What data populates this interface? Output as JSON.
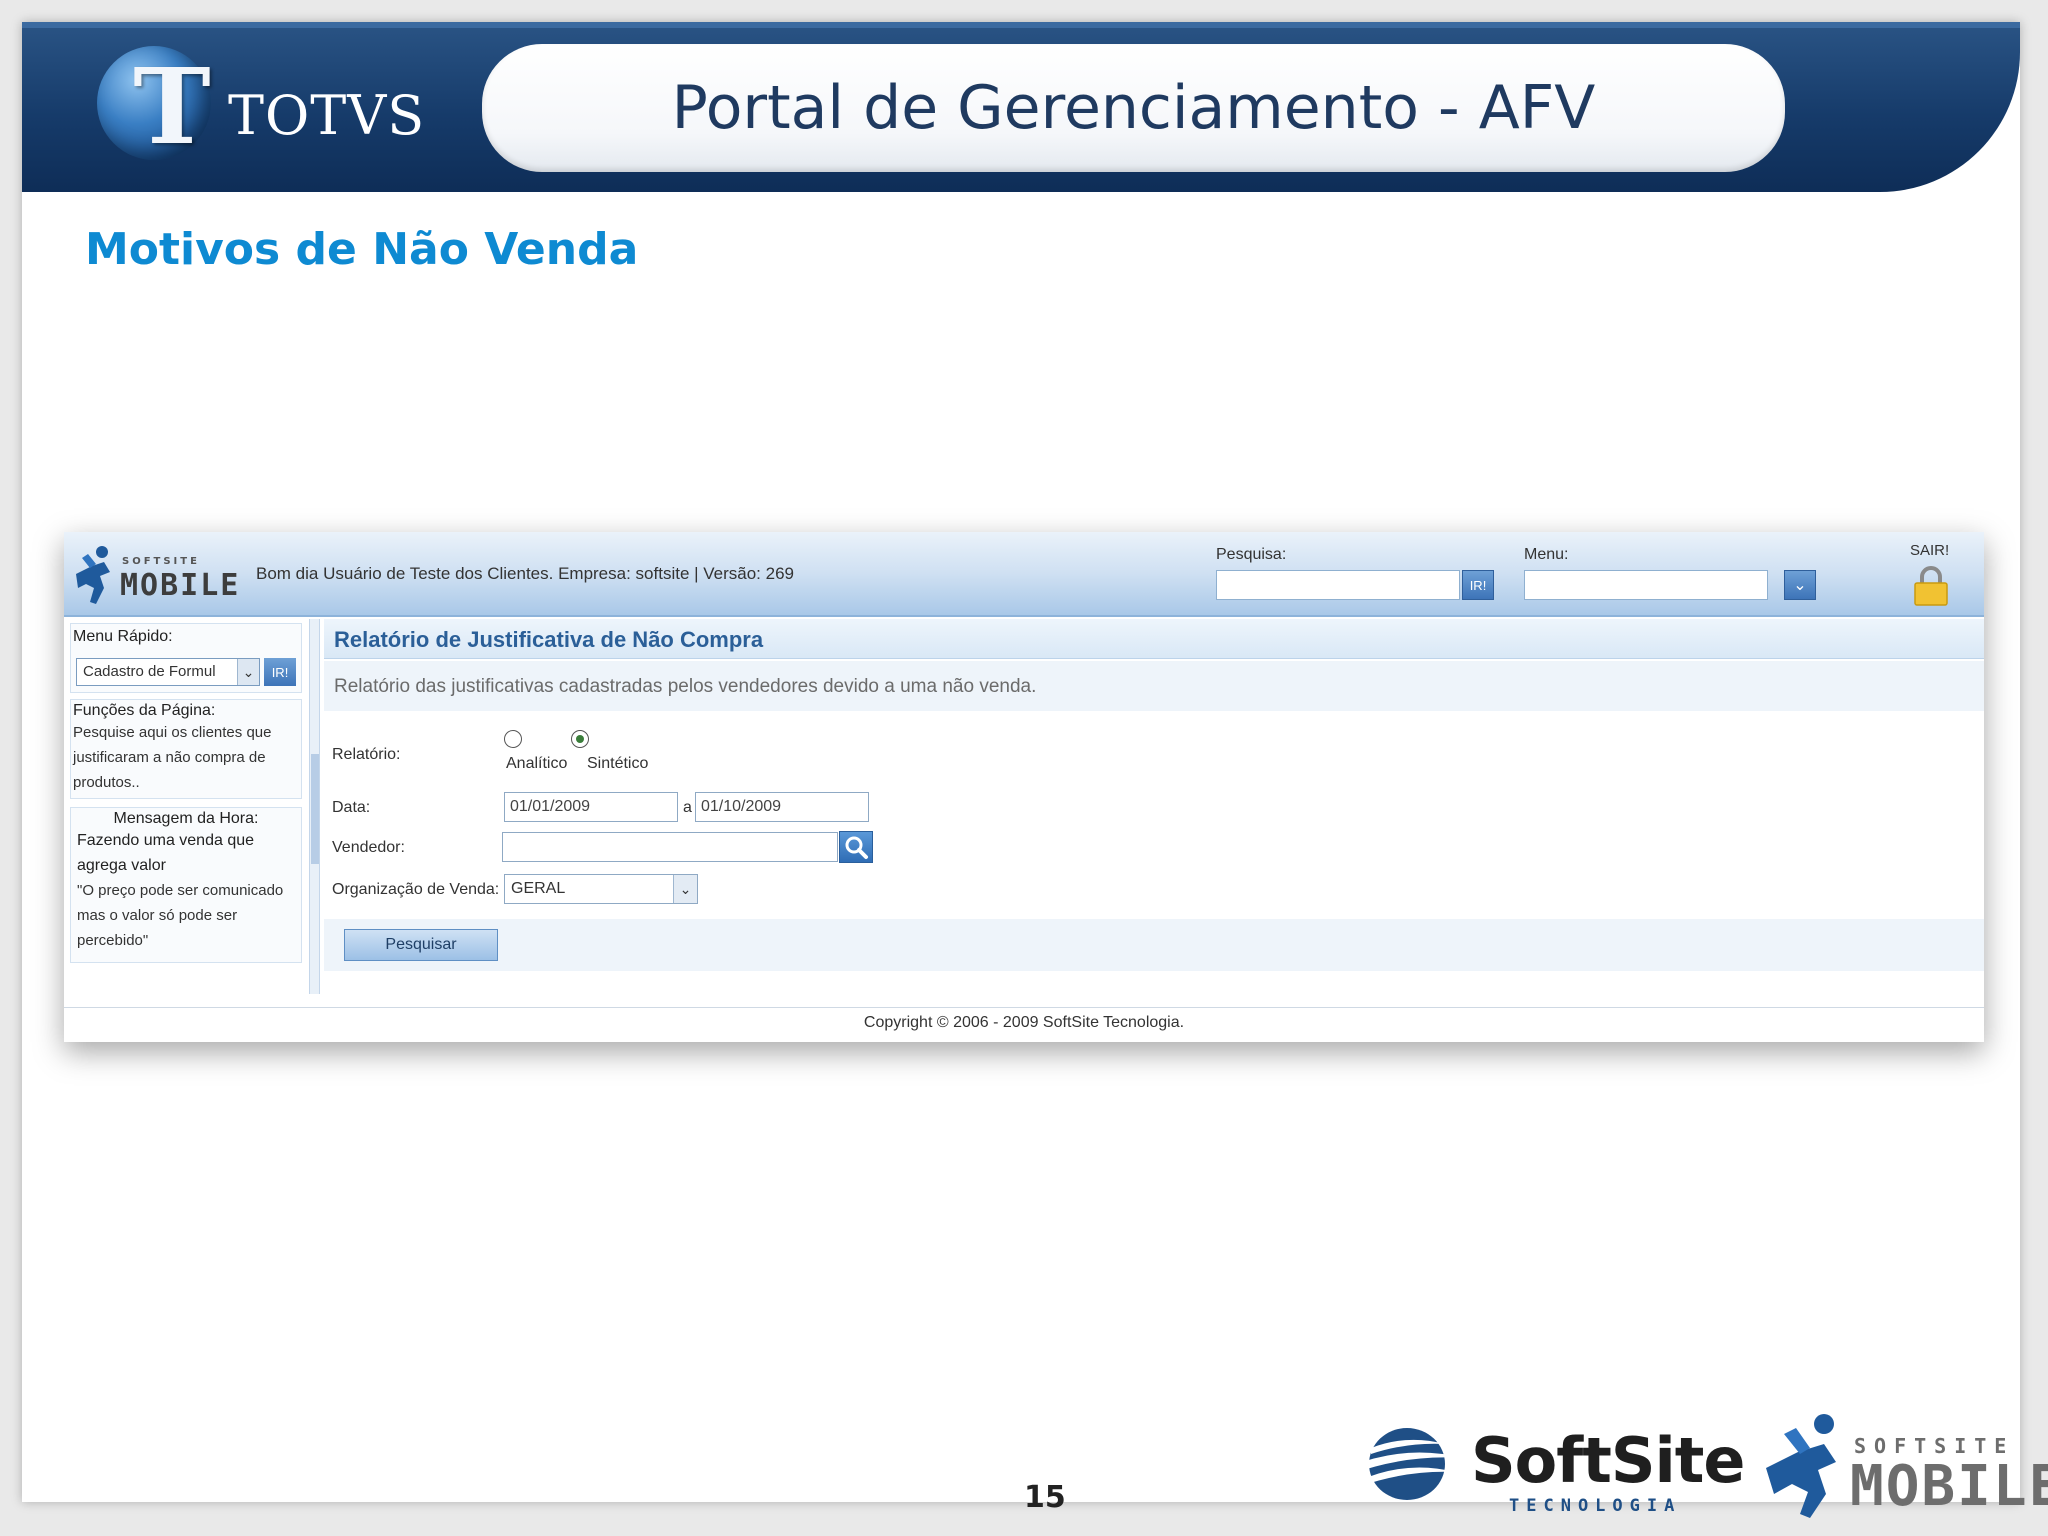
{
  "slide": {
    "brand": "TOTVS",
    "brand_letter": "T",
    "title": "Portal de Gerenciamento - AFV",
    "section_title": "Motivos de Não Venda",
    "page_number": "15"
  },
  "app": {
    "logo_small": "SOFTSITE",
    "logo_big": "MOBILE",
    "greeting": "Bom dia Usuário de Teste dos Clientes. Empresa: softsite | Versão: 269",
    "search_label": "Pesquisa:",
    "search_value": "",
    "search_button": "IR!",
    "menu_label": "Menu:",
    "menu_value": "",
    "logout_label": "SAIR!",
    "sidebar": {
      "quick_menu_title": "Menu Rápido:",
      "quick_menu_selected": "Cadastro de Formul",
      "quick_menu_button": "IR!",
      "functions_title": "Funções da Página:",
      "functions_text": "Pesquise aqui os clientes que justificaram a não compra de produtos..",
      "message_title": "Mensagem da Hora:",
      "message_heading": "Fazendo uma venda que agrega valor",
      "message_text": "\"O preço pode ser comunicado mas o valor só pode ser percebido\""
    },
    "main": {
      "title": "Relatório de Justificativa de Não Compra",
      "description": "Relatório das justificativas cadastradas pelos vendedores devido a uma não venda.",
      "report_label": "Relatório:",
      "report_options": [
        "Analítico",
        "Sintético"
      ],
      "report_selected": "Sintético",
      "date_label": "Data:",
      "date_from": "01/01/2009",
      "date_sep": "a",
      "date_to": "01/10/2009",
      "seller_label": "Vendedor:",
      "seller_value": "",
      "org_label": "Organização de Venda:",
      "org_selected": "GERAL",
      "search_button": "Pesquisar"
    },
    "copyright": "Copyright © 2006 - 2009 SoftSite Tecnologia."
  },
  "footer_logos": {
    "softsite_word": "SoftSite",
    "softsite_sub": "TECNOLOGIA",
    "mobile_small": "SOFTSITE",
    "mobile_big": "MOBILE"
  },
  "colors": {
    "header_dark": "#163b6a",
    "section_title": "#0e8ad2",
    "app_title": "#2b5f98",
    "accent_button": "#3d74b8"
  }
}
